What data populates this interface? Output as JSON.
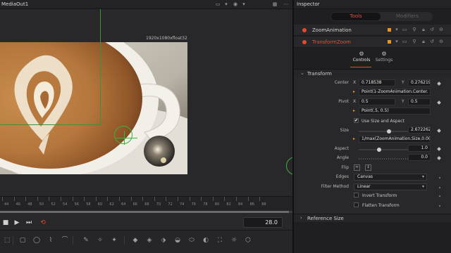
{
  "viewer": {
    "title": "MediaOut1",
    "resolution": "1920x1080xfloat32",
    "header_buttons": [
      "display-icon",
      "chevron-down-icon",
      "color-icon",
      "chevron-down-icon",
      "checker-icon",
      "more-icon"
    ]
  },
  "timeline": {
    "ticks": [
      "44",
      "46",
      "48",
      "50",
      "52",
      "54",
      "56",
      "58",
      "60",
      "62",
      "64",
      "66",
      "68",
      "70",
      "72",
      "74",
      "76",
      "78",
      "80",
      "82",
      "84",
      "86",
      "88"
    ],
    "progress_fraction": 0.99
  },
  "transport": {
    "current_frame": "28.0",
    "loop_color": "#e24a32"
  },
  "toolbar": {
    "tools": [
      "rect-icon",
      "ellipse-icon",
      "polygon-icon",
      "bspline-icon",
      "paint-icon",
      "particle-icon",
      "text-icon",
      "shape-icon",
      "merge-icon",
      "transform-icon",
      "mask-icon",
      "blur-icon",
      "color-icon",
      "camera-icon",
      "light-icon",
      "renderer-icon"
    ]
  },
  "inspector": {
    "title": "Inspector",
    "tabs": {
      "tools": "Tools",
      "modifiers": "Modifiers"
    },
    "nodes": [
      {
        "label": "ZoomAnimation",
        "color": "#e24a32",
        "label_color": "#d6d6d6"
      },
      {
        "label": "TransformZoom",
        "color": "#e24a32",
        "label_color": "#e0523a"
      }
    ],
    "subtabs": {
      "controls": "Controls",
      "settings": "Settings"
    },
    "transform_section": "Transform",
    "params": {
      "center": {
        "label": "Center",
        "x_axis": "X",
        "x": "0.718538",
        "y_axis": "Y",
        "y": "0.276219",
        "expr": "Point(1-ZoomAnimation.Center."
      },
      "pivot": {
        "label": "Pivot",
        "x_axis": "X",
        "x": "0.5",
        "y_axis": "Y",
        "y": "0.5",
        "expr": "Point(.5, 0.5)"
      },
      "use_size_aspect": {
        "label": "Use Size and Aspect",
        "checked": true
      },
      "size": {
        "label": "Size",
        "value": "2.672262",
        "expr": "1/max(ZoomAnimation.Size,0.00"
      },
      "aspect": {
        "label": "Aspect",
        "value": "1.0",
        "slider_fraction": 0.4
      },
      "angle": {
        "label": "Angle",
        "value": "0.0"
      },
      "flip": {
        "label": "Flip"
      },
      "edges": {
        "label": "Edges",
        "value": "Canvas"
      },
      "filter_method": {
        "label": "Filter Method",
        "value": "Linear"
      },
      "invert_transform": {
        "label": "Invert Transform",
        "checked": false
      },
      "flatten_transform": {
        "label": "Flatten Transform",
        "checked": false
      }
    },
    "reference_size_section": "Reference Size"
  },
  "colors": {
    "accent": "#e24a32",
    "keyframe_orange": "#e8962a",
    "guide_green": "#3fb03f"
  }
}
